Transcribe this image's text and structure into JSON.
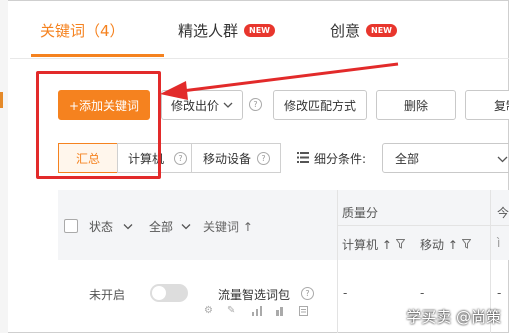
{
  "tabs": [
    {
      "label": "关键词（4）",
      "badge": ""
    },
    {
      "label": "精选人群",
      "badge": "NEW"
    },
    {
      "label": "创意",
      "badge": "NEW"
    }
  ],
  "toolbar": {
    "add_keyword": "+添加关键词",
    "modify_bid": "修改出价",
    "modify_match": "修改匹配方式",
    "delete": "删除",
    "copy": "复制"
  },
  "segments": [
    "汇总",
    "计算机",
    "移动设备"
  ],
  "filter": {
    "label": "细分条件:",
    "value": "全部"
  },
  "table": {
    "status_header": "状态",
    "status_filter": "全部",
    "keyword_header": "关键词 ↑",
    "quality_header": "质量分",
    "quality_pc": "计算机 ↑",
    "quality_mobile": "移动 ↑",
    "next_col_header": "今",
    "row": {
      "status": "未开启",
      "keyword": "流量智选词包",
      "pc_value": "-",
      "mobile_value": "-",
      "next_value": "-"
    }
  },
  "watermark": "学买卖 @尚策",
  "colors": {
    "accent": "#f5821f",
    "badge": "#e8362d",
    "annotation": "#e22a2a"
  }
}
